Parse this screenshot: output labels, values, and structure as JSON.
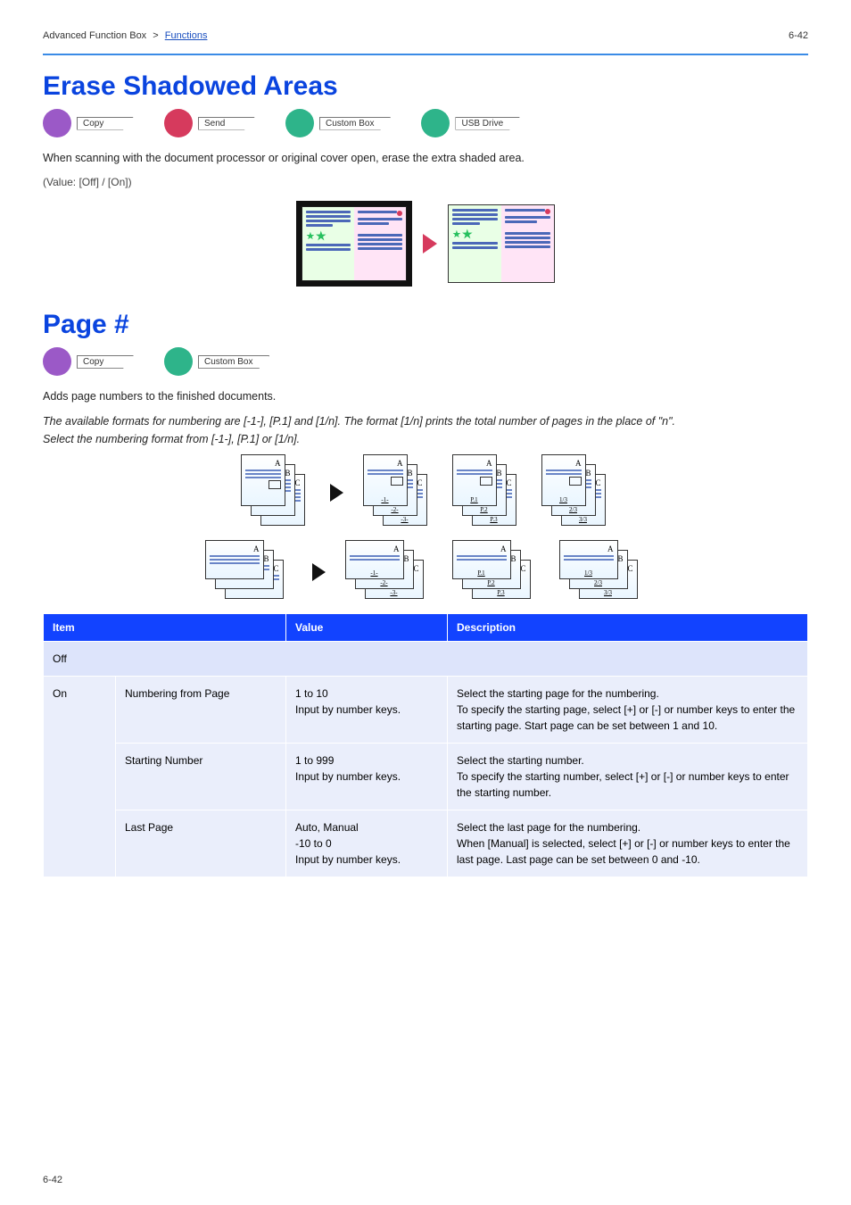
{
  "breadcrumb": {
    "current": "Advanced Function Box",
    "sep": ">",
    "link": "Functions"
  },
  "page_ref": "6-42",
  "section1": {
    "title": "Erase Shadowed Areas",
    "badges": [
      "Copy",
      "Send",
      "Custom Box",
      "USB Drive"
    ],
    "desc": "When scanning with the document processor or original cover open, erase the extra shaded area.",
    "note_label": "(Value: [Off] / [On])",
    "fig_label_before": "",
    "fig_label_after": ""
  },
  "section2": {
    "title": "Page #",
    "badges": [
      "Copy",
      "Custom Box"
    ],
    "desc": "Adds page numbers to the finished documents.",
    "formats_line": "The available formats for numbering are [-1-], [P.1] and [1/n]. The format [1/n] prints the total number of pages in the place of \"n\".",
    "select_line": "Select the numbering format from [-1-], [P.1] or [1/n].",
    "stack_labels": {
      "plain": [
        "A",
        "B",
        "C"
      ],
      "fmt1": [
        "-1-",
        "-2-",
        "-3-"
      ],
      "fmt2": [
        "P.1",
        "P.2",
        "P.3"
      ],
      "fmt3": [
        "1/3",
        "2/3",
        "3/3"
      ]
    },
    "table": {
      "headers": [
        "Item",
        "",
        "Value",
        "Description"
      ],
      "off_row": [
        "Off",
        "",
        "",
        ""
      ],
      "rows": [
        {
          "group": "On",
          "item": "Numbering from Page",
          "value": "1 to 10\nInput by number keys.",
          "desc": "Select the starting page for the numbering.\nTo specify the starting page, select [+] or [-] or number keys to enter the starting page. Start page can be set between 1 and 10."
        },
        {
          "group": "",
          "item": "Starting Number",
          "value": "1 to 999\nInput by number keys.",
          "desc": "Select the starting number.\nTo specify the starting number, select [+] or [-] or number keys to enter the starting number."
        },
        {
          "group": "",
          "item": "Last Page",
          "value": "Auto, Manual\n-10 to 0\nInput by number keys.",
          "desc": "Select the last page for the numbering.\nWhen [Manual] is selected, select [+] or [-] or number keys to enter the last page. Last page can be set between 0 and -10."
        }
      ]
    }
  }
}
